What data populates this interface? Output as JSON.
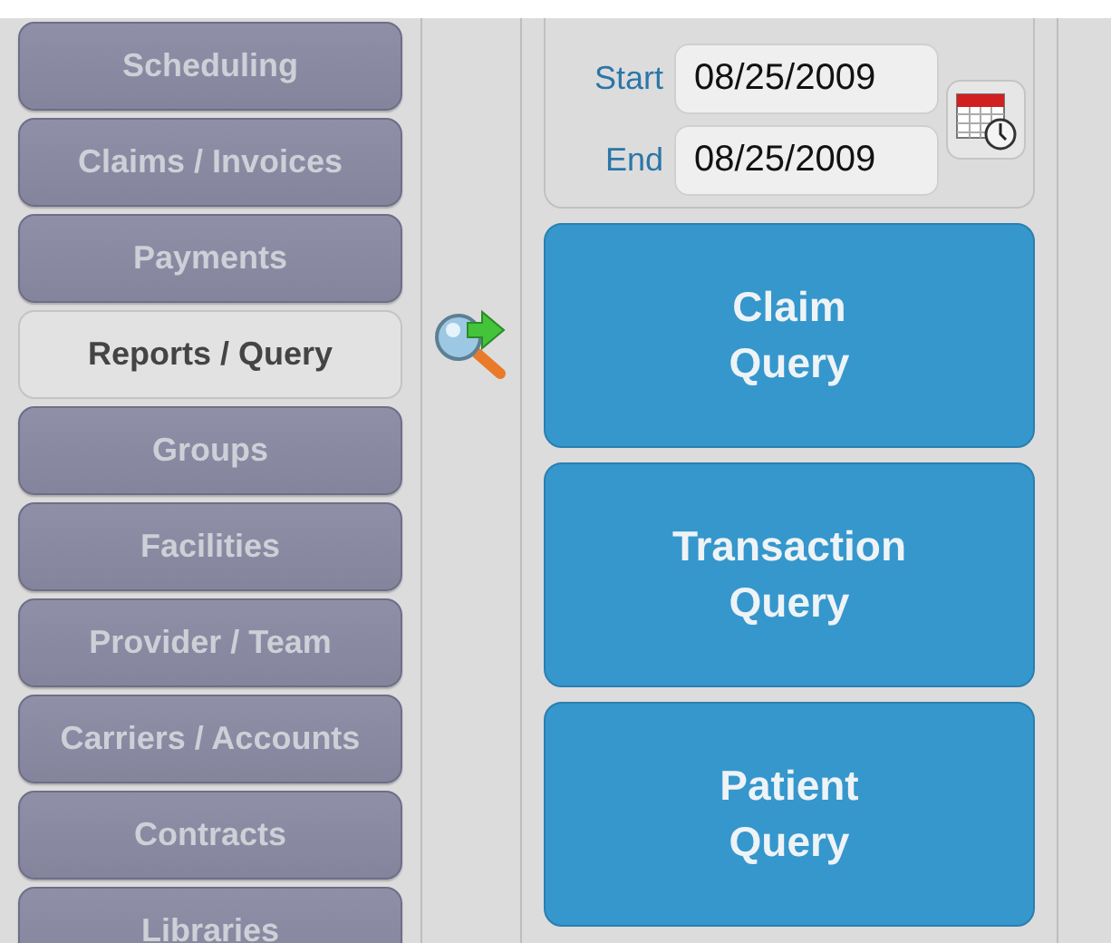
{
  "sidebar": {
    "items": [
      {
        "label": "Scheduling",
        "selected": false
      },
      {
        "label": "Claims / Invoices",
        "selected": false
      },
      {
        "label": "Payments",
        "selected": false
      },
      {
        "label": "Reports / Query",
        "selected": true
      },
      {
        "label": "Groups",
        "selected": false
      },
      {
        "label": "Facilities",
        "selected": false
      },
      {
        "label": "Provider / Team",
        "selected": false
      },
      {
        "label": "Carriers / Accounts",
        "selected": false
      },
      {
        "label": "Contracts",
        "selected": false
      },
      {
        "label": "Libraries",
        "selected": false
      }
    ]
  },
  "date_range": {
    "start_label": "Start",
    "start_value": "08/25/2009",
    "end_label": "End",
    "end_value": "08/25/2009"
  },
  "queries": [
    {
      "line1": "Claim",
      "line2": "Query"
    },
    {
      "line1": "Transaction",
      "line2": "Query"
    },
    {
      "line1": "Patient",
      "line2": "Query"
    }
  ]
}
